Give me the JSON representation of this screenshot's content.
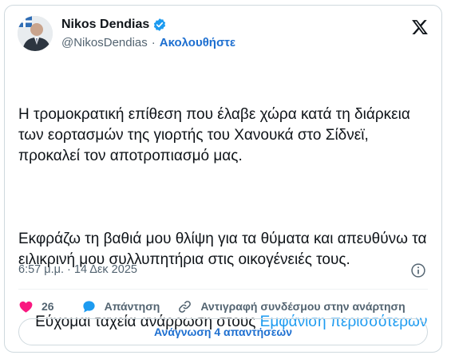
{
  "author": {
    "name": "Nikos Dendias",
    "handle": "@NikosDendias",
    "separator": "·",
    "follow_label": "Ακολουθήστε"
  },
  "tweet": {
    "paragraphs": [
      "Η τρομοκρατική επίθεση που έλαβε χώρα κατά τη διάρκεια των εορτασμών της γιορτής του Χανουκά στο Σίδνεϊ, προκαλεί τον αποτροπιασμό μας.",
      "Εκφράζω τη βαθιά μου θλίψη για τα θύματα και απευθύνω τα ειλικρινή μου συλλυπητήρια στις οικογένειές τους."
    ],
    "last_paragraph": "Εύχομαι ταχεία ανάρρωση στους ",
    "show_more_label": "Εμφάνιση περισσότερων",
    "timestamp": "6:57 μ.μ. · 14 Δεκ 2025"
  },
  "actions": {
    "like_count": "26",
    "reply_label": "Απάντηση",
    "copy_link_label": "Αντιγραφή συνδέσμου στην ανάρτηση"
  },
  "read_replies_label": "Ανάγνωση 4 απαντήσεων",
  "icons": {
    "verified": "verified-badge-icon",
    "logo": "x-logo-icon",
    "info": "info-icon",
    "like": "heart-icon",
    "reply": "reply-bubble-icon",
    "copy_link": "link-icon"
  },
  "colors": {
    "link_blue": "#1d9bf0",
    "follow_blue": "#1d6fd0",
    "like_pink": "#f91880",
    "reply_blue": "#1d9bf0",
    "muted": "#536471"
  }
}
